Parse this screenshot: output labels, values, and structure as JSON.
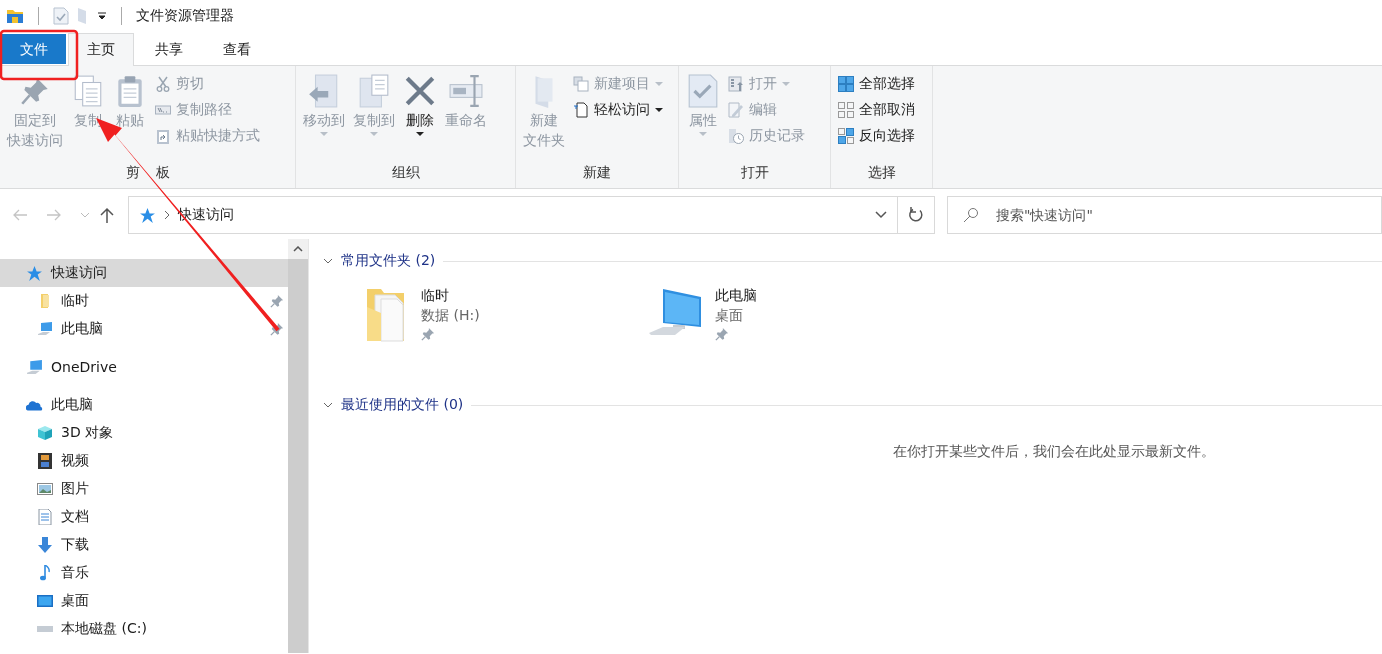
{
  "window": {
    "title": "文件资源管理器"
  },
  "tabs": [
    {
      "label": "文件",
      "kind": "file",
      "selected": false
    },
    {
      "label": "主页",
      "kind": "tab",
      "selected": true
    },
    {
      "label": "共享",
      "kind": "tab",
      "selected": false
    },
    {
      "label": "查看",
      "kind": "tab",
      "selected": false
    }
  ],
  "ribbon": {
    "groups": [
      {
        "label_parts": [
          "剪",
          "板"
        ],
        "buttons": [
          {
            "label_lines": [
              "固定到",
              "快速访问"
            ],
            "kind": "large",
            "disabled": true,
            "dropdown": false
          },
          {
            "label": "复制",
            "kind": "large",
            "disabled": true,
            "dropdown": false
          },
          {
            "label": "粘贴",
            "kind": "large",
            "disabled": true,
            "dropdown": false
          },
          {
            "label": "剪切",
            "kind": "small",
            "disabled": true,
            "dropdown": false
          },
          {
            "label": "复制路径",
            "kind": "small",
            "disabled": true,
            "dropdown": false
          },
          {
            "label": "粘贴快捷方式",
            "kind": "small",
            "disabled": true,
            "dropdown": false
          }
        ]
      },
      {
        "label": "组织",
        "buttons": [
          {
            "label": "移动到",
            "kind": "large",
            "disabled": true,
            "dropdown": true
          },
          {
            "label": "复制到",
            "kind": "large",
            "disabled": true,
            "dropdown": true
          },
          {
            "label": "删除",
            "kind": "large",
            "disabled": false,
            "dropdown": true
          },
          {
            "label": "重命名",
            "kind": "large",
            "disabled": true,
            "dropdown": false
          }
        ]
      },
      {
        "label": "新建",
        "buttons": [
          {
            "label_lines": [
              "新建",
              "文件夹"
            ],
            "kind": "large",
            "disabled": true,
            "dropdown": false
          },
          {
            "label": "新建项目",
            "kind": "small",
            "disabled": true,
            "dropdown": true
          },
          {
            "label": "轻松访问",
            "kind": "small",
            "disabled": false,
            "dropdown": true
          }
        ]
      },
      {
        "label": "打开",
        "buttons": [
          {
            "label": "属性",
            "kind": "large",
            "disabled": true,
            "dropdown": true
          },
          {
            "label": "打开",
            "kind": "small",
            "disabled": true,
            "dropdown": true
          },
          {
            "label": "编辑",
            "kind": "small",
            "disabled": true,
            "dropdown": false
          },
          {
            "label": "历史记录",
            "kind": "small",
            "disabled": true,
            "dropdown": false
          }
        ]
      },
      {
        "label": "选择",
        "buttons": [
          {
            "label": "全部选择",
            "kind": "small",
            "disabled": false,
            "dropdown": false
          },
          {
            "label": "全部取消",
            "kind": "small",
            "disabled": false,
            "dropdown": false
          },
          {
            "label": "反向选择",
            "kind": "small",
            "disabled": false,
            "dropdown": false
          }
        ]
      }
    ]
  },
  "address_bar": {
    "back_disabled": true,
    "forward_disabled": true,
    "path": "快速访问",
    "search": {
      "placeholder": "搜索\"快速访问\""
    }
  },
  "navigation": {
    "items": [
      {
        "label": "快速访问",
        "selected": true,
        "children": [
          {
            "label": "临时",
            "selected": false,
            "pinned": true
          },
          {
            "label": "此电脑",
            "selected": false,
            "pinned": true
          }
        ]
      },
      {
        "label": "OneDrive",
        "selected": false
      },
      {
        "label": "此电脑",
        "selected": false,
        "children": [
          {
            "label": "3D 对象",
            "selected": false
          },
          {
            "label": "视频",
            "selected": false
          },
          {
            "label": "图片",
            "selected": false
          },
          {
            "label": "文档",
            "selected": false
          },
          {
            "label": "下载",
            "selected": false
          },
          {
            "label": "音乐",
            "selected": false
          },
          {
            "label": "桌面",
            "selected": false
          },
          {
            "label": "本地磁盘 (C:)",
            "selected": false
          }
        ]
      }
    ]
  },
  "content": {
    "sections": [
      {
        "title": "常用文件夹 (2)",
        "expanded": true,
        "items": [
          {
            "name": "临时",
            "detail": "数据 (H:)",
            "pinned": true
          },
          {
            "name": "此电脑",
            "detail": "桌面",
            "pinned": true
          }
        ]
      },
      {
        "title": "最近使用的文件 (0)",
        "expanded": true,
        "empty_text": "在你打开某些文件后，我们会在此处显示最新文件。"
      }
    ]
  }
}
